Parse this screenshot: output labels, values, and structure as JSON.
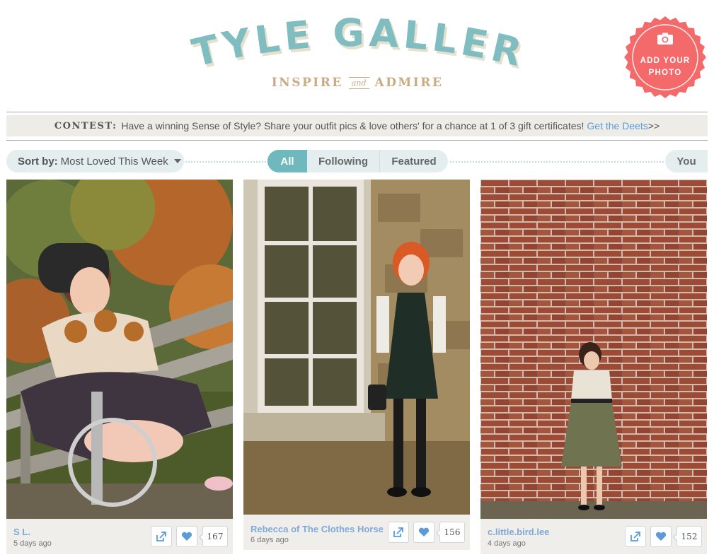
{
  "header": {
    "title": "STYLE GALLERY",
    "tagline_left": "INSPIRE",
    "tagline_and": "and",
    "tagline_right": "ADMIRE",
    "add_photo_line1": "ADD YOUR",
    "add_photo_line2": "PHOTO",
    "colors": {
      "title": "#7fbdc0",
      "title_shadow": "#e8e0cf",
      "tagline": "#c9ac83",
      "add_photo": "#f4696a"
    }
  },
  "contest": {
    "tag": "CONTEST:",
    "text": "Have a winning Sense of Style? Share your outfit pics & love others' for a chance at 1 of 3 gift certificates!",
    "link": "Get the Deets",
    "link_suffix": ">>"
  },
  "filters": {
    "sort_label": "Sort by:",
    "sort_value": "Most Loved This Week",
    "tabs": [
      "All",
      "Following",
      "Featured"
    ],
    "active_tab": "All",
    "you": "You"
  },
  "cards": [
    {
      "author": "S L.",
      "age": "5 days ago",
      "loves": "167",
      "icons": [
        "share-icon",
        "heart-icon"
      ]
    },
    {
      "author": "Rebecca of The Clothes Horse",
      "age": "6 days ago",
      "loves": "156",
      "icons": [
        "share-icon",
        "heart-icon"
      ]
    },
    {
      "author": "c.little.bird.lee",
      "age": "4 days ago",
      "loves": "152",
      "icons": [
        "share-icon",
        "heart-icon"
      ]
    }
  ]
}
